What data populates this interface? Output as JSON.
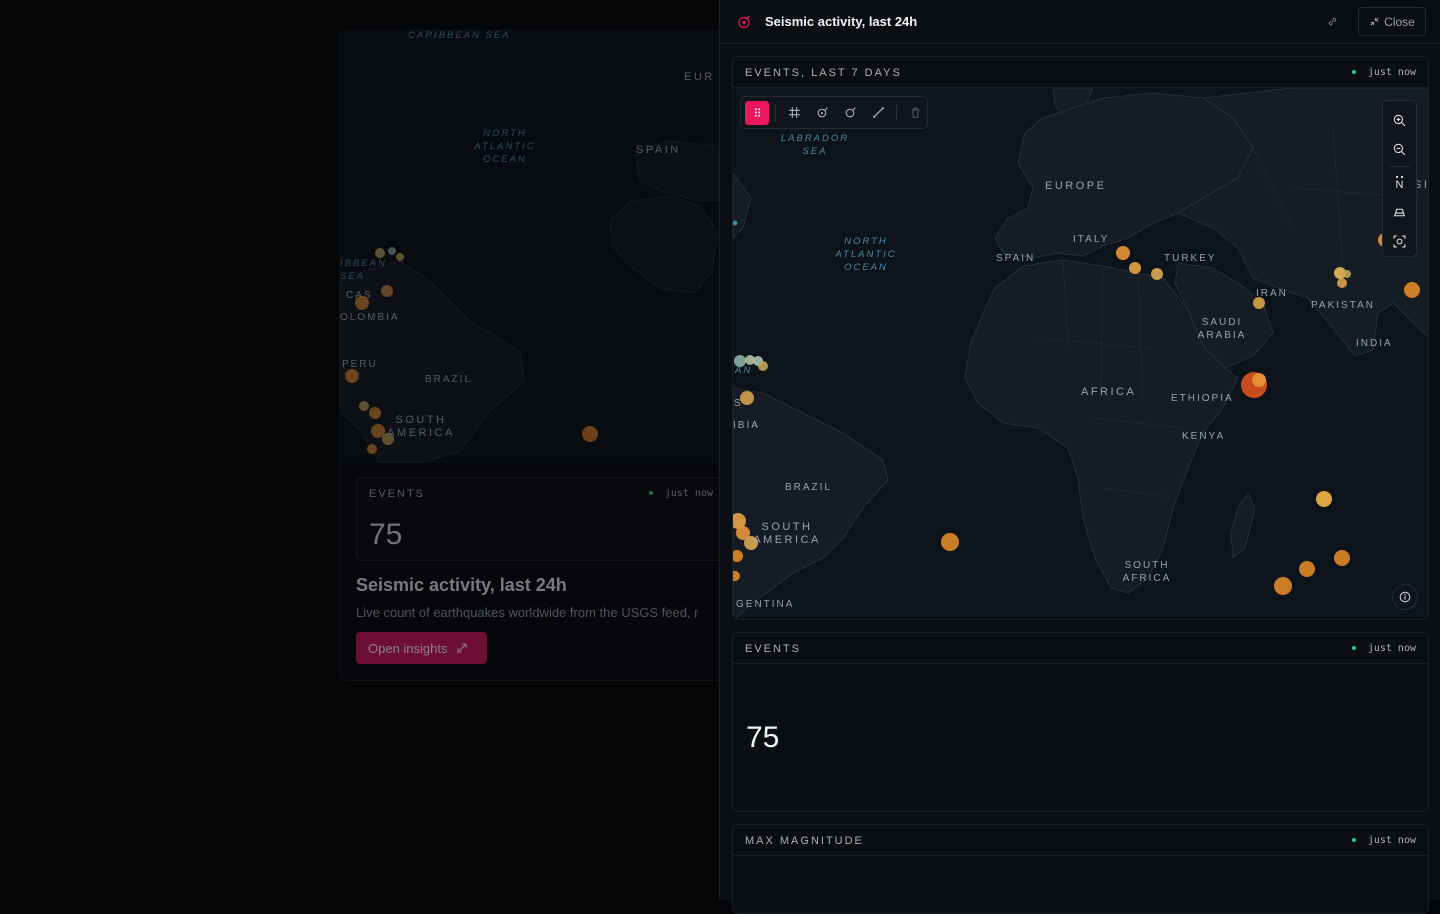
{
  "background_card": {
    "events_label": "EVENTS",
    "events_timestamp": "just now",
    "events_value": "75",
    "title": "Seismic activity, last 24h",
    "description": "Live count of earthquakes worldwide from the USGS feed, r",
    "open_button_label": "Open insights",
    "map_labels": [
      {
        "text": "CARIBBEAN SEA",
        "kind": "sea"
      },
      {
        "text": "NORTH ATLANTIC OCEAN",
        "kind": "sea"
      },
      {
        "text": "SPAIN",
        "kind": "land"
      },
      {
        "text": "EUR",
        "kind": "land"
      },
      {
        "text": "IBBEAN SEA",
        "kind": "sea"
      },
      {
        "text": "CAS",
        "kind": "land"
      },
      {
        "text": "OLOMBIA",
        "kind": "land"
      },
      {
        "text": "PERU",
        "kind": "land"
      },
      {
        "text": "BRAZIL",
        "kind": "land"
      },
      {
        "text": "SOUTH AMERICA",
        "kind": "land"
      }
    ]
  },
  "panel": {
    "title": "Seismic activity, last 24h",
    "close_label": "Close",
    "accent_color": "#e9175d",
    "map_card": {
      "label": "EVENTS, LAST 7 DAYS",
      "timestamp": "just now",
      "map_labels": [
        {
          "text": "LABRADOR SEA",
          "kind": "sea"
        },
        {
          "text": "EUROPE",
          "kind": "land"
        },
        {
          "text": "ITALY",
          "kind": "land"
        },
        {
          "text": "SPAIN",
          "kind": "land"
        },
        {
          "text": "TURKEY",
          "kind": "land"
        },
        {
          "text": "NORTH ATLANTIC OCEAN",
          "kind": "sea"
        },
        {
          "text": "IRAN",
          "kind": "land"
        },
        {
          "text": "PAKISTAN",
          "kind": "land"
        },
        {
          "text": "SAUDI ARABIA",
          "kind": "land"
        },
        {
          "text": "INDIA",
          "kind": "land"
        },
        {
          "text": "AFRICA",
          "kind": "land"
        },
        {
          "text": "ETHIOPIA",
          "kind": "land"
        },
        {
          "text": "KENYA",
          "kind": "land"
        },
        {
          "text": "BRAZIL",
          "kind": "land"
        },
        {
          "text": "SOUTH AMERICA",
          "kind": "land"
        },
        {
          "text": "SOUTH AFRICA",
          "kind": "land"
        },
        {
          "text": "GENTINA",
          "kind": "land"
        },
        {
          "text": "AN",
          "kind": "sea"
        },
        {
          "text": "IBIA",
          "kind": "land"
        },
        {
          "text": "S",
          "kind": "land"
        },
        {
          "text": "SI",
          "kind": "land"
        }
      ],
      "toolbar_icons": [
        "drag-handle-icon",
        "grid-icon",
        "point-icon",
        "circle-icon",
        "line-icon",
        "trash-icon"
      ],
      "zoom_controls": [
        "zoom-in-icon",
        "zoom-out-icon",
        "compass-icon",
        "perspective-icon",
        "screenshot-icon"
      ],
      "compass_label": "N"
    },
    "events_card": {
      "label": "EVENTS",
      "timestamp": "just now",
      "value": "75"
    },
    "max_magnitude_card": {
      "label": "MAX MAGNITUDE",
      "timestamp": "just now"
    }
  }
}
